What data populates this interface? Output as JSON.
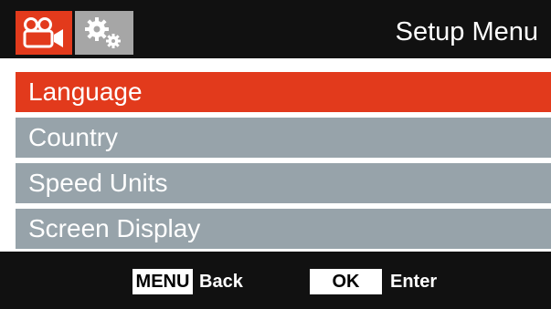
{
  "header": {
    "title": "Setup Menu",
    "tabs": [
      {
        "icon": "video-camera-icon",
        "active": true
      },
      {
        "icon": "gears-icon",
        "active": false
      }
    ]
  },
  "menu": {
    "items": [
      {
        "label": "Language",
        "selected": true
      },
      {
        "label": "Country",
        "selected": false
      },
      {
        "label": "Speed Units",
        "selected": false
      },
      {
        "label": "Screen Display",
        "selected": false
      }
    ]
  },
  "footer": {
    "menu_key": "MENU",
    "menu_action": "Back",
    "ok_key": "OK",
    "ok_action": "Enter"
  },
  "colors": {
    "accent": "#e23a1c",
    "item_bg": "#97a3aa",
    "bar_bg": "#111111",
    "inactive_tab": "#a6a6a6"
  }
}
